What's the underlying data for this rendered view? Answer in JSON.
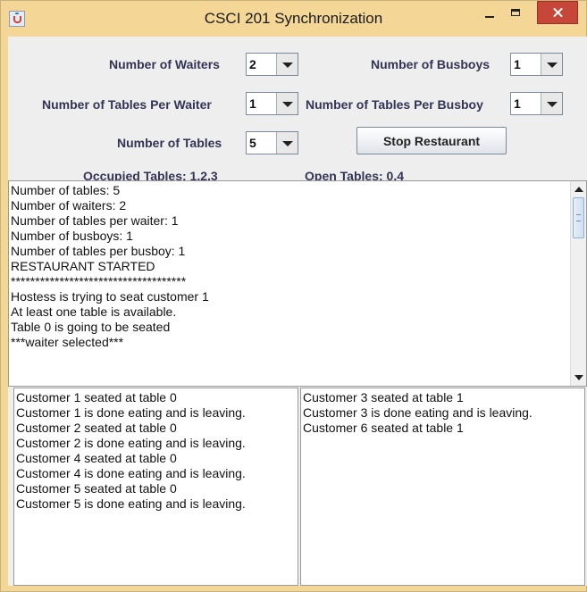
{
  "window": {
    "title": "CSCI 201 Synchronization"
  },
  "controls": {
    "waiters_label": "Number of Waiters",
    "waiters_value": "2",
    "busboys_label": "Number of Busboys",
    "busboys_value": "1",
    "tables_per_waiter_label": "Number of Tables Per Waiter",
    "tables_per_waiter_value": "1",
    "tables_per_busboy_label": "Number of Tables Per Busboy",
    "tables_per_busboy_value": "1",
    "tables_label": "Number of Tables",
    "tables_value": "5",
    "stop_button_label": "Stop Restaurant"
  },
  "status": {
    "occupied_tables": "Occupied Tables: 1,2,3",
    "open_tables": "Open Tables: 0,4"
  },
  "log": {
    "lines": [
      "Number of tables: 5",
      "Number of waiters: 2",
      "Number of tables per waiter: 1",
      "Number of busboys: 1",
      "Number of tables per busboy: 1",
      "RESTAURANT STARTED",
      "************************************",
      "Hostess is trying to seat customer 1",
      "At least one table is available.",
      "Table 0 is going to be seated",
      "***waiter selected***"
    ]
  },
  "left_panel": {
    "lines": [
      "Customer 1 seated at table 0",
      "Customer 1 is done eating and is leaving.",
      "Customer 2 seated at table 0",
      "Customer 2 is done eating and is leaving.",
      "Customer 4 seated at table 0",
      "Customer 4 is done eating and is leaving.",
      "Customer 5 seated at table 0",
      "Customer 5 is done eating and is leaving."
    ]
  },
  "right_panel": {
    "lines": [
      "Customer 3 seated at table 1",
      "Customer 3 is done eating and is leaving.",
      "Customer 6 seated at table 1"
    ]
  },
  "icons": {
    "app": "java-cup-icon",
    "minimize": "minimize-icon",
    "maximize": "maximize-icon",
    "close": "close-icon",
    "dropdown": "chevron-down-icon"
  },
  "colors": {
    "title_bar": "#f4d796",
    "close_button": "#c7463a",
    "label_text": "#333355"
  }
}
